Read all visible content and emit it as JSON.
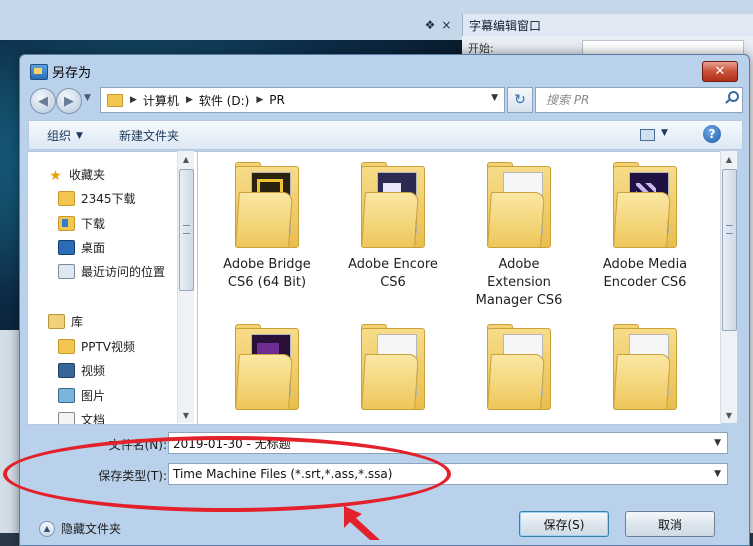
{
  "background_app": {
    "pin_glyph": "❖",
    "close_glyph": "×",
    "right_panel_title": "字幕编辑窗口",
    "right_panel_label": "开始:"
  },
  "dialog": {
    "title": "另存为",
    "close_glyph": "✕",
    "address": {
      "breadcrumbs": [
        "计算机",
        "软件 (D:)",
        "PR"
      ]
    },
    "search": {
      "placeholder": "搜索 PR"
    },
    "toolbar": {
      "organize_label": "组织",
      "new_folder_label": "新建文件夹",
      "help_glyph": "?"
    },
    "nav_items": [
      {
        "label": "收藏夹",
        "icon": "star-icon"
      },
      {
        "label": "2345下载",
        "icon": "folder-icon"
      },
      {
        "label": "下载",
        "icon": "download-folder-icon"
      },
      {
        "label": "桌面",
        "icon": "desktop-icon"
      },
      {
        "label": "最近访问的位置",
        "icon": "recent-places-icon"
      },
      {
        "label": "库",
        "icon": "library-icon"
      },
      {
        "label": "PPTV视频",
        "icon": "folder-icon"
      },
      {
        "label": "视频",
        "icon": "video-library-icon"
      },
      {
        "label": "图片",
        "icon": "pictures-library-icon"
      },
      {
        "label": "文档",
        "icon": "documents-library-icon"
      }
    ],
    "files": [
      {
        "name_line1": "Adobe Bridge",
        "name_line2": "CS6 (64 Bit)",
        "name_line3": ""
      },
      {
        "name_line1": "Adobe Encore",
        "name_line2": "CS6",
        "name_line3": ""
      },
      {
        "name_line1": "Adobe",
        "name_line2": "Extension",
        "name_line3": "Manager CS6"
      },
      {
        "name_line1": "Adobe Media",
        "name_line2": "Encoder CS6",
        "name_line3": ""
      },
      {
        "name_line1": "",
        "name_line2": "",
        "name_line3": ""
      },
      {
        "name_line1": "",
        "name_line2": "",
        "name_line3": ""
      },
      {
        "name_line1": "",
        "name_line2": "",
        "name_line3": ""
      },
      {
        "name_line1": "",
        "name_line2": "",
        "name_line3": ""
      }
    ],
    "filename": {
      "label": "文件名(N):",
      "value": "2019-01-30 - 无标题"
    },
    "filetype": {
      "label": "保存类型(T):",
      "value": "Time Machine Files (*.srt,*.ass,*.ssa)"
    },
    "hide_folders_label": "隐藏文件夹",
    "save_label": "保存(S)",
    "cancel_label": "取消"
  }
}
